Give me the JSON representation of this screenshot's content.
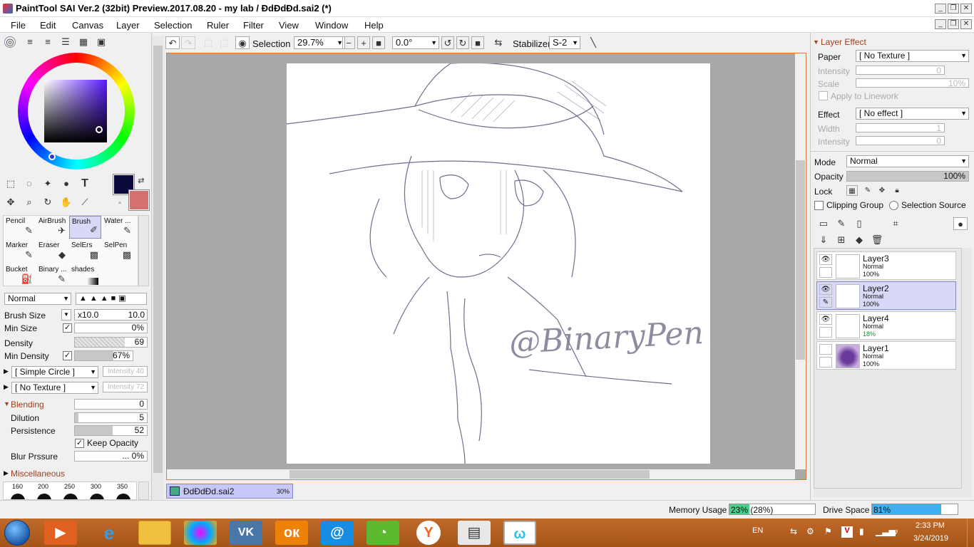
{
  "window": {
    "title": "PaintTool SAI Ver.2 (32bit) Preview.2017.08.20 - my lab / ĐdĐdĐd.sai2 (*)"
  },
  "menu": [
    "File",
    "Edit",
    "Canvas",
    "Layer",
    "Selection",
    "Ruler",
    "Filter",
    "View",
    "Window",
    "Help"
  ],
  "toolbar": {
    "selection_label": "Selection",
    "zoom": "29.7%",
    "rotation": "0.0°",
    "stabilizer_label": "Stabilizer",
    "stabilizer_value": "S-2"
  },
  "colors": {
    "primary": "#0a0a3a",
    "secondary": "#d47070",
    "accent": "#c8c8f8"
  },
  "tools": [
    {
      "label": "Pencil",
      "icon": "pencil-icon"
    },
    {
      "label": "AirBrush",
      "icon": "airbrush-icon"
    },
    {
      "label": "Brush",
      "icon": "brush-icon"
    },
    {
      "label": "Water ...",
      "icon": "water-icon"
    },
    {
      "label": "Marker",
      "icon": "marker-icon"
    },
    {
      "label": "Eraser",
      "icon": "eraser-icon"
    },
    {
      "label": "SelErs",
      "icon": "selers-icon"
    },
    {
      "label": "SelPen",
      "icon": "selpen-icon"
    },
    {
      "label": "Bucket",
      "icon": "bucket-icon"
    },
    {
      "label": "Binary ...",
      "icon": "binary-icon"
    },
    {
      "label": "shades",
      "icon": "shades-icon"
    }
  ],
  "brush": {
    "mode": "Normal",
    "brush_size_label": "Brush Size",
    "brush_size_mult": "x10.0",
    "brush_size_value": "10.0",
    "min_size_label": "Min Size",
    "min_size_value": "0%",
    "density_label": "Density",
    "density_value": "69",
    "min_density_label": "Min Density",
    "min_density_value": "67%",
    "shape": "[ Simple Circle ]",
    "shape_intensity": "Intensity 40",
    "texture": "[ No Texture ]",
    "texture_intensity": "Intensity 72",
    "blending_label": "Blending",
    "blending_value": "0",
    "dilution_label": "Dilution",
    "dilution_value": "5",
    "persistence_label": "Persistence",
    "persistence_value": "52",
    "keep_opacity_label": "Keep Opacity",
    "blur_label": "Blur Prssure",
    "blur_value": "... 0%",
    "misc_label": "Miscellaneous",
    "sizes": [
      "160",
      "200",
      "250",
      "300",
      "350"
    ]
  },
  "document_tab": {
    "name": "ĐdĐdĐd.sai2",
    "zoom": "30%"
  },
  "canvas": {
    "signature": "@BinaryPen"
  },
  "layer_effect": {
    "title": "Layer Effect",
    "paper_label": "Paper",
    "paper_value": "[ No Texture ]",
    "intensity_label": "Intensity",
    "intensity_value": "0",
    "scale_label": "Scale",
    "scale_value": "10%",
    "apply_label": "Apply to Linework",
    "effect_label": "Effect",
    "effect_value": "[ No effect ]",
    "width_label": "Width",
    "width_value": "1",
    "intensity2_label": "Intensity",
    "intensity2_value": "0"
  },
  "layer_props": {
    "mode_label": "Mode",
    "mode_value": "Normal",
    "opacity_label": "Opacity",
    "opacity_value": "100%",
    "lock_label": "Lock",
    "clipping_label": "Clipping Group",
    "selection_source_label": "Selection Source"
  },
  "layers": [
    {
      "name": "Layer3",
      "mode": "Normal",
      "opacity": "100%"
    },
    {
      "name": "Layer2",
      "mode": "Normal",
      "opacity": "100%"
    },
    {
      "name": "Layer4",
      "mode": "Normal",
      "opacity": "18%"
    },
    {
      "name": "Layer1",
      "mode": "Normal",
      "opacity": "100%"
    }
  ],
  "status": {
    "memory_label": "Memory Usage",
    "memory_value": "23% (28%)",
    "memory_fraction": 0.23,
    "drive_label": "Drive Space",
    "drive_value": "81%",
    "drive_fraction": 0.81
  },
  "taskbar": {
    "language": "EN",
    "time": "2:33 PM",
    "date": "3/24/2019"
  }
}
